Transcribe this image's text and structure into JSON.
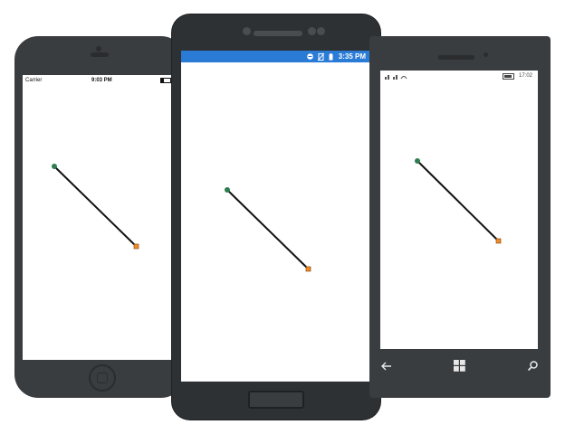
{
  "ios": {
    "status": {
      "carrier": "Carrier",
      "time": "9:03 PM"
    },
    "line": {
      "start_color": "#2e7d4f",
      "end_color": "#f28c28",
      "stroke": "#111111"
    }
  },
  "android": {
    "status": {
      "time": "3:35 PM",
      "bar_color": "#2a7bd6"
    },
    "line": {
      "start_color": "#2e7d4f",
      "end_color": "#f28c28",
      "stroke": "#111111"
    }
  },
  "windows": {
    "status": {
      "time": "17:02"
    },
    "nav": {
      "back": "back-icon",
      "start": "windows-logo-icon",
      "search": "search-icon"
    },
    "line": {
      "start_color": "#2e7d4f",
      "end_color": "#f28c28",
      "stroke": "#111111"
    }
  }
}
